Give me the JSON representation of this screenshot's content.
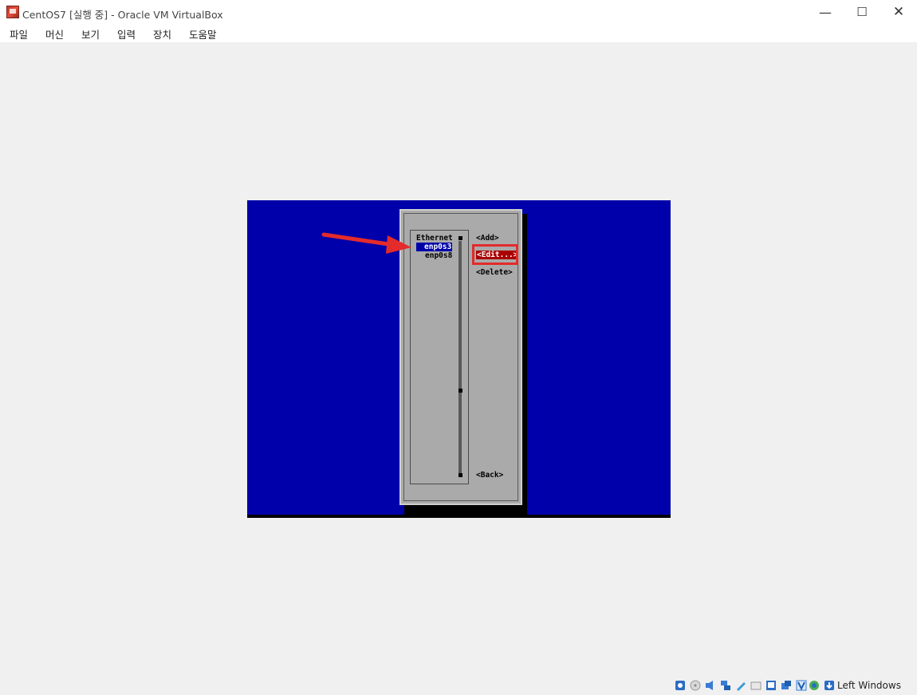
{
  "window": {
    "title": "CentOS7 [실행 중] - Oracle VM VirtualBox",
    "minimize": "—",
    "maximize": "☐",
    "close": "✕"
  },
  "menu": [
    "파일",
    "머신",
    "보기",
    "입력",
    "장치",
    "도움말"
  ],
  "nmtui": {
    "group_header": "Ethernet",
    "connections": [
      "enp0s3",
      "enp0s8"
    ],
    "selected_connection": "enp0s3",
    "buttons": {
      "add": "<Add>",
      "edit": "<Edit...>",
      "delete": "<Delete>",
      "back": "<Back>"
    }
  },
  "annotation": {
    "arrow_color": "#e32b2b",
    "highlight_color": "#e32b2b"
  },
  "statusbar": {
    "icons": [
      "harddisk-icon",
      "optical-drive-icon",
      "audio-icon",
      "network-icon",
      "usb-icon",
      "shared-folders-icon",
      "display-icon",
      "video-capture-icon",
      "recording-icon",
      "cpu-icon",
      "mouse-integration-icon",
      "keyboard-icon"
    ],
    "host_key": "Left Windows"
  },
  "colors": {
    "console_bg": "#0000aa",
    "dialog_bg": "#aaaaaa",
    "selection_bg": "#0000aa",
    "focus_bg": "#aa0000"
  }
}
